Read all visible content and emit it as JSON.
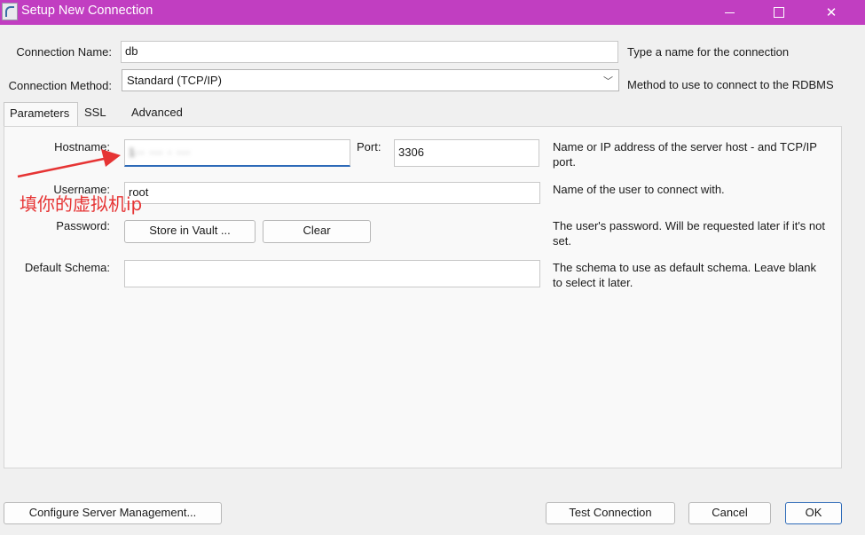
{
  "window": {
    "title": "Setup New Connection",
    "controls": {
      "minimize": "—",
      "maximize": "☐",
      "close": "✕"
    }
  },
  "form": {
    "connection_name_label": "Connection Name:",
    "connection_name_value": "db",
    "connection_name_help": "Type a name for the connection",
    "connection_method_label": "Connection Method:",
    "connection_method_value": "Standard (TCP/IP)",
    "connection_method_help": "Method to use to connect to the RDBMS"
  },
  "tabs": [
    {
      "label": "Parameters",
      "active": true
    },
    {
      "label": "SSL",
      "active": false
    },
    {
      "label": "Advanced",
      "active": false
    }
  ],
  "parameters": {
    "hostname_label": "Hostname:",
    "hostname_value": "1·· ··· · ···",
    "port_label": "Port:",
    "port_value": "3306",
    "hostname_help": "Name or IP address of the server host - and TCP/IP port.",
    "username_label": "Username:",
    "username_value": "root",
    "username_help": "Name of the user to connect with.",
    "password_label": "Password:",
    "store_vault_label": "Store in Vault ...",
    "clear_label": "Clear",
    "password_help": "The user's password. Will be requested later if it's not set.",
    "default_schema_label": "Default Schema:",
    "default_schema_value": "",
    "default_schema_help": "The schema to use as default schema. Leave blank to select it later."
  },
  "annotation": {
    "text": "填你的虚拟机ip",
    "color": "#e63434"
  },
  "footer": {
    "configure_label": "Configure Server Management...",
    "test_label": "Test Connection",
    "cancel_label": "Cancel",
    "ok_label": "OK"
  },
  "colors": {
    "titlebar": "#c13ec1",
    "accent": "#2d6ab8"
  }
}
